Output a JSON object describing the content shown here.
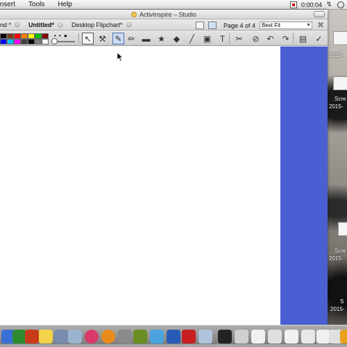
{
  "menubar": {
    "items": [
      "Insert",
      "Tools",
      "Help"
    ],
    "clock": "0:00:04"
  },
  "window": {
    "title": "ActivInspire – Studio",
    "tabs": [
      {
        "label": "and *"
      },
      {
        "label": "Untitled*"
      },
      {
        "label": "Desktop Flipchart*"
      }
    ],
    "page_indicator": "Page 4 of 4",
    "zoom": {
      "selected": "Best Fit"
    }
  },
  "palette": {
    "colors": [
      "#000000",
      "#7a3a1a",
      "#ff0000",
      "#ff8000",
      "#ffff00",
      "#00c000",
      "#800000",
      "#0000ff",
      "#00c0ff",
      "#ff00ff",
      "#404040",
      "#000000",
      "#808080",
      "#ffffff"
    ]
  },
  "toolbar": {
    "pen_dots": "• • ●",
    "tools": [
      {
        "name": "select-tool",
        "glyph": "↖",
        "state": "active"
      },
      {
        "name": "tools-tool",
        "glyph": "⚒",
        "state": "normal"
      },
      {
        "name": "pen-tool",
        "glyph": "✎",
        "state": "selected"
      },
      {
        "name": "highlighter-tool",
        "glyph": "✏",
        "state": "normal"
      },
      {
        "name": "eraser-tool",
        "glyph": "▬",
        "state": "normal"
      },
      {
        "name": "magic-ink-tool",
        "glyph": "★",
        "state": "normal"
      },
      {
        "name": "shape-tool",
        "glyph": "◆",
        "state": "normal"
      },
      {
        "name": "connector-tool",
        "glyph": "╱",
        "state": "normal"
      },
      {
        "name": "fill-tool",
        "glyph": "▣",
        "state": "normal"
      },
      {
        "name": "text-tool",
        "glyph": "T",
        "state": "normal"
      },
      {
        "name": "cut-tool",
        "glyph": "✂",
        "state": "normal"
      },
      {
        "name": "clear-tool",
        "glyph": "⊘",
        "state": "normal"
      },
      {
        "name": "undo-tool",
        "glyph": "↶",
        "state": "normal"
      },
      {
        "name": "redo-tool",
        "glyph": "↷",
        "state": "normal"
      },
      {
        "name": "page-tool",
        "glyph": "▤",
        "state": "normal"
      },
      {
        "name": "settings-tool",
        "glyph": "✓",
        "state": "normal"
      }
    ]
  },
  "desktop": {
    "items": [
      {
        "label_1": "Scre",
        "label_2": "2015-"
      },
      {
        "label_1": "Scre",
        "label_2": "2015-"
      },
      {
        "label_1": "Scre",
        "label_2": "2015-"
      },
      {
        "label_1": "S",
        "label_2": "2015-"
      }
    ]
  },
  "dock": {
    "icons": [
      "finder-icon",
      "tools-icon",
      "powerpoint-icon",
      "notes-icon",
      "photos-icon",
      "preview-icon",
      "itunes-icon",
      "ibooks-icon",
      "system-preferences-icon",
      "notebook-icon",
      "activinspire-icon",
      "word-icon",
      "acrobat-icon",
      "image-icon",
      "terminal-icon",
      "folder-icon",
      "doc-icon",
      "doc-icon",
      "doc-icon",
      "doc-icon",
      "doc-icon",
      "doc-icon",
      "doc-icon"
    ],
    "icon_colors": [
      "#3a6fd8",
      "#2e8b2e",
      "#c83a1a",
      "#f2d34a",
      "#7a8bb0",
      "#9ab3cf",
      "#d93a6a",
      "#e98b1a",
      "#8a8a8a",
      "#6b8e23",
      "#4aa3df",
      "#2a5ab8",
      "#c82020",
      "#b0c4de",
      "#222222",
      "#d0d0d0",
      "#f0f0f0",
      "#e0e0e0",
      "#f0f0f0",
      "#e8e8e8",
      "#f0f0f0",
      "#e0e0e0",
      "#e9a01a"
    ]
  }
}
